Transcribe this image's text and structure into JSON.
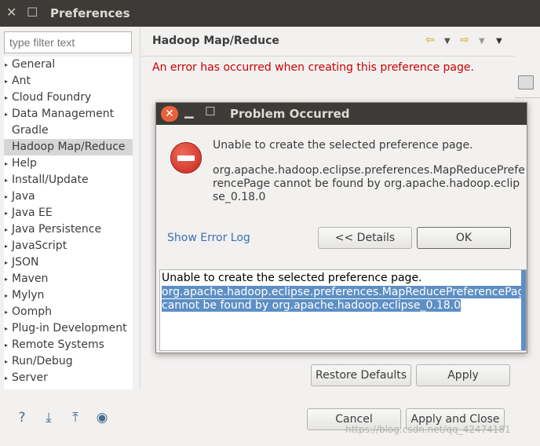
{
  "window": {
    "title": "Preferences",
    "close_glyph": "✕",
    "min_glyph": "☐"
  },
  "filter": {
    "placeholder": "type filter text"
  },
  "tree": {
    "items": [
      {
        "label": "General",
        "expandable": true
      },
      {
        "label": "Ant",
        "expandable": true
      },
      {
        "label": "Cloud Foundry",
        "expandable": true
      },
      {
        "label": "Data Management",
        "expandable": true
      },
      {
        "label": "Gradle",
        "expandable": false
      },
      {
        "label": "Hadoop Map/Reduce",
        "expandable": false,
        "selected": true
      },
      {
        "label": "Help",
        "expandable": true
      },
      {
        "label": "Install/Update",
        "expandable": true
      },
      {
        "label": "Java",
        "expandable": true
      },
      {
        "label": "Java EE",
        "expandable": true
      },
      {
        "label": "Java Persistence",
        "expandable": true
      },
      {
        "label": "JavaScript",
        "expandable": true
      },
      {
        "label": "JSON",
        "expandable": true
      },
      {
        "label": "Maven",
        "expandable": true
      },
      {
        "label": "Mylyn",
        "expandable": true
      },
      {
        "label": "Oomph",
        "expandable": true
      },
      {
        "label": "Plug-in Development",
        "expandable": true
      },
      {
        "label": "Remote Systems",
        "expandable": true
      },
      {
        "label": "Run/Debug",
        "expandable": true
      },
      {
        "label": "Server",
        "expandable": true
      }
    ]
  },
  "page": {
    "title": "Hadoop Map/Reduce",
    "error": "An error has occurred when creating this preference page.",
    "restore_defaults": "Restore Defaults",
    "apply": "Apply"
  },
  "footer": {
    "cancel": "Cancel",
    "apply_and_close": "Apply and Close"
  },
  "dialog": {
    "title": "Problem Occurred",
    "message": "Unable to create the selected preference page.",
    "detail": "org.apache.hadoop.eclipse.preferences.MapReducePreferencePage cannot be found by org.apache.hadoop.eclipse_0.18.0",
    "show_error_log": "Show Error Log",
    "details_button": "<< Details",
    "ok_button": "OK",
    "details_text_line1": "Unable to create the selected preference page.",
    "details_text_selected": "org.apache.hadoop.eclipse.preferences.MapReducePreferencePage cannot be found by org.apache.hadoop.eclipse_0.18.0"
  },
  "watermark": "https://blog.csdn.net/qq_42474181",
  "colors": {
    "titlebar": "#3c3b37",
    "error_text": "#cc0000",
    "selection": "#5d8fc4",
    "link": "#3c6fb4",
    "close_button": "#e8613a"
  }
}
